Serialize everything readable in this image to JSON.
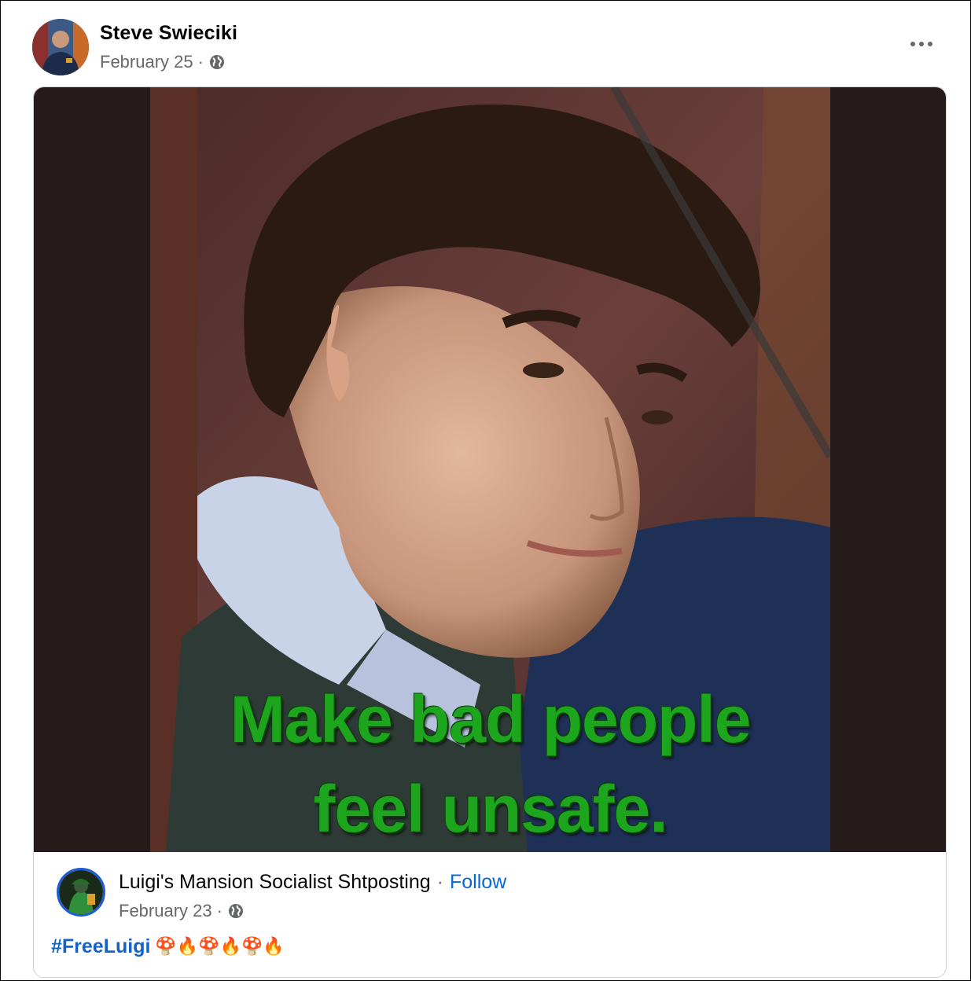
{
  "post": {
    "author": "Steve Swieciki",
    "date": "February 25",
    "separator": "·",
    "privacy_icon": "globe-icon",
    "more_icon": "more-options-icon"
  },
  "shared": {
    "meme_line1": "Make bad people",
    "meme_line2": "feel unsafe.",
    "page_name": "Luigi's Mansion Socialist Shtposting",
    "separator": "·",
    "follow_label": "Follow",
    "date": "February 23",
    "hashtag": "#FreeLuigi",
    "emojis": "🍄🔥🍄🔥🍄🔥"
  },
  "colors": {
    "link_blue": "#0a66d8",
    "meme_green": "#1ea51e",
    "meta_gray": "#65676b"
  }
}
